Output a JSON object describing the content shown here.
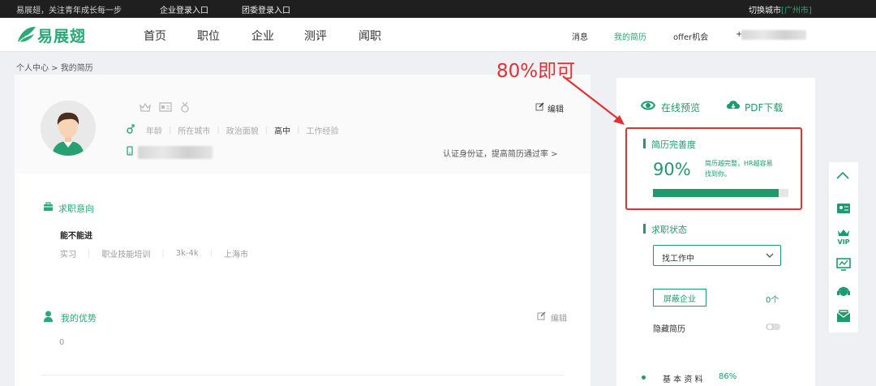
{
  "topbar": {
    "slogan": "易展翅，关注青年成长每一步",
    "company_login": "企业登录入口",
    "league_login": "团委登录入口",
    "switch_city": "切换城市",
    "city": "[广州市]"
  },
  "nav": {
    "logo_text": "易展翅",
    "items": [
      "首页",
      "职位",
      "企业",
      "测评",
      "闻职"
    ],
    "right": [
      "消息",
      "我的简历",
      "offer机会"
    ],
    "user_prefix": "+"
  },
  "breadcrumb": "个人中心 > 我的简历",
  "annotation": "80%即可",
  "profile": {
    "edit": "编辑",
    "meta": [
      "年龄",
      "所在城市",
      "政治面貌",
      "高中",
      "工作经验"
    ],
    "verify_hint": "认证身份证，提高简历通过率 >"
  },
  "intention": {
    "title": "求职意向",
    "position": "能不能进",
    "tags": [
      "实习",
      "职业技能培训",
      "3k-4k",
      "上海市"
    ]
  },
  "advantage": {
    "title": "我的优势",
    "edit": "编辑",
    "value": "0"
  },
  "sidebar": {
    "preview": "在线预览",
    "pdf": "PDF下载",
    "completeness_title": "简历完善度",
    "completeness_value": "90%",
    "completeness_fraction": 0.93,
    "completeness_hint_1": "简历越完整，HR越容易",
    "completeness_hint_2": "找到你。",
    "status_title": "求职状态",
    "status_value": "找工作中",
    "block_button": "屏蔽企业",
    "block_count": "0个",
    "hide_resume": "隐藏简历",
    "basic_label": "基 本 资 料",
    "basic_value": "86%"
  },
  "colors": {
    "accent": "#2aa876",
    "annotation": "#e03232"
  }
}
